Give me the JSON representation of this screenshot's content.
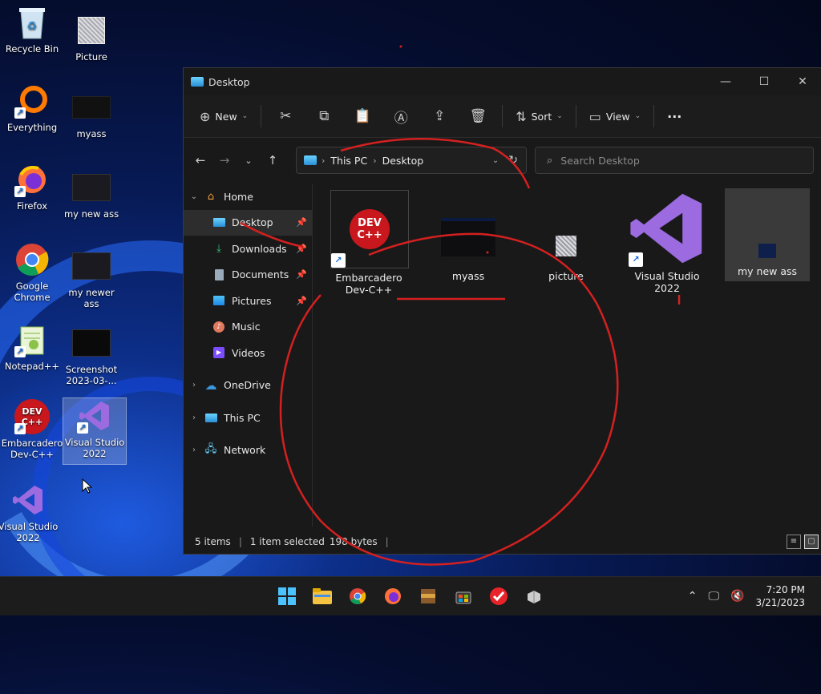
{
  "desktop": {
    "icons": [
      {
        "label": "Recycle Bin"
      },
      {
        "label": "Picture"
      },
      {
        "label": "Everything"
      },
      {
        "label": "myass"
      },
      {
        "label": "Firefox"
      },
      {
        "label": "my new ass"
      },
      {
        "label": "Google Chrome"
      },
      {
        "label": "my newer ass"
      },
      {
        "label": "Notepad++"
      },
      {
        "label": "Screenshot 2023-03-..."
      },
      {
        "label": "Embarcadero Dev-C++"
      },
      {
        "label": "Visual Studio 2022"
      },
      {
        "label": "Visual Studio 2022"
      }
    ]
  },
  "window": {
    "title": "Desktop",
    "controls": {
      "minimize": "—",
      "maximize": "☐",
      "close": "✕"
    }
  },
  "toolbar": {
    "new_label": "New",
    "sort_label": "Sort",
    "view_label": "View",
    "more_label": "···"
  },
  "address": {
    "crumbs": [
      "This PC",
      "Desktop"
    ]
  },
  "search": {
    "placeholder": "Search Desktop"
  },
  "sidebar": {
    "home": "Home",
    "quick": [
      "Desktop",
      "Downloads",
      "Documents",
      "Pictures",
      "Music",
      "Videos"
    ],
    "onedrive": "OneDrive",
    "thispc": "This PC",
    "network": "Network"
  },
  "files": [
    {
      "name": "Embarcadero Dev-C++"
    },
    {
      "name": "myass"
    },
    {
      "name": "picture"
    },
    {
      "name": "Visual Studio 2022"
    },
    {
      "name": "my new ass"
    }
  ],
  "status": {
    "count": "5 items",
    "selected": "1 item selected",
    "size": "198 bytes"
  },
  "taskbar": {
    "time": "7:20 PM",
    "date": "3/21/2023"
  },
  "colors": {
    "accent_red": "#d42020",
    "window_bg": "#191919"
  }
}
